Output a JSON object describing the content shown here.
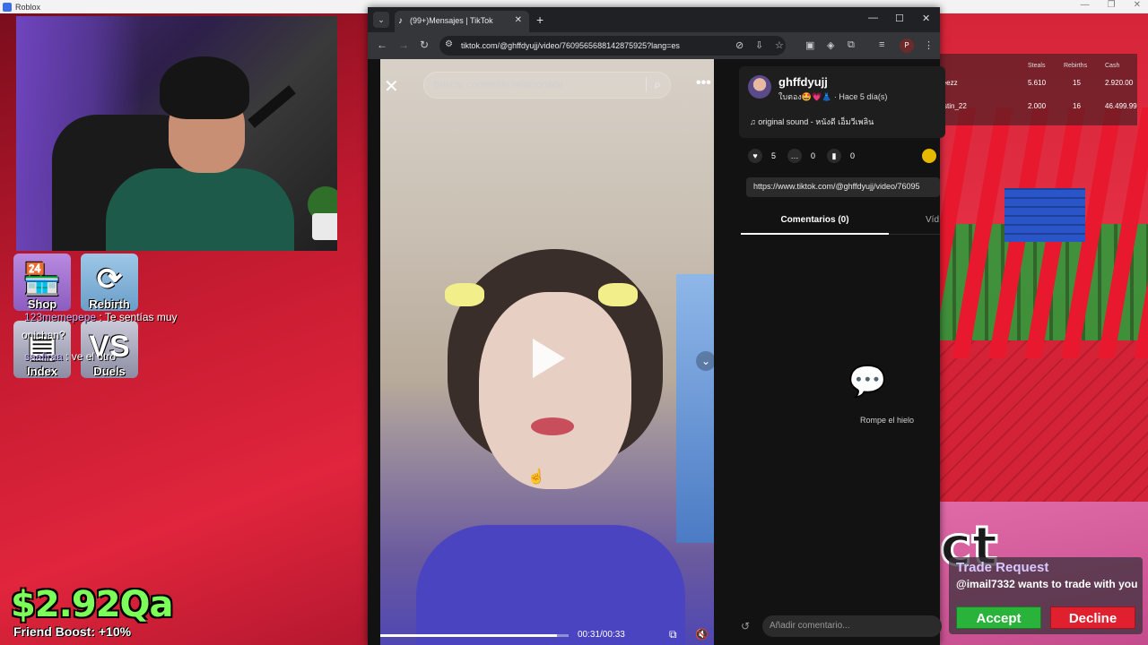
{
  "roblox": {
    "window_title": "Roblox"
  },
  "hud": {
    "shop_label": "Shop",
    "rebirth_label": "Rebirth",
    "index_label": "Index",
    "duels_label": "Duels",
    "money": "$2.92Qa",
    "friend_boost": "Friend Boost: +10%"
  },
  "chat": [
    {
      "name": "123memepepe",
      "text": " : Te sentías muy"
    },
    {
      "name": "",
      "text": "onichan?"
    },
    {
      "name": "saafiraa",
      "text": " : ve el otro"
    }
  ],
  "leaderboard": {
    "headers": [
      "Steals",
      "Rebirths",
      "Cash"
    ],
    "rows": [
      {
        "player": "reezz",
        "steals": "5.610",
        "rebirths": "15",
        "cash": "2.920.00"
      },
      {
        "player": "vstin_22",
        "steals": "2.000",
        "rebirths": "16",
        "cash": "46.499.99"
      }
    ]
  },
  "trade": {
    "title": "Trade Request",
    "message": "@imail7332 wants to trade with you",
    "accept": "Accept",
    "decline": "Decline"
  },
  "browser": {
    "tab_title": "(99+)Mensajes | TikTok",
    "url": "tiktok.com/@ghffdyujj/video/7609565688142875925?lang=es",
    "profile_initial": "P"
  },
  "video": {
    "search_placeholder": "Buscar contenido relacionado",
    "time": "00:31/00:33",
    "progress": 0.94
  },
  "info": {
    "author": "ghffdyujj",
    "author_sub": "ใบตอง🤩💗👗 · Hace 5 día(s)",
    "sound": "♫  original sound - หนังดี เอ็มวีเพลิน",
    "likes": "5",
    "comments": "0",
    "saves": "0",
    "link": "https://www.tiktok.com/@ghffdyujj/video/76095",
    "tab_comments": "Comentarios (0)",
    "tab_videos": "Víd",
    "empty_text": "Rompe el hielo",
    "comment_placeholder": "Añadir comentario..."
  }
}
